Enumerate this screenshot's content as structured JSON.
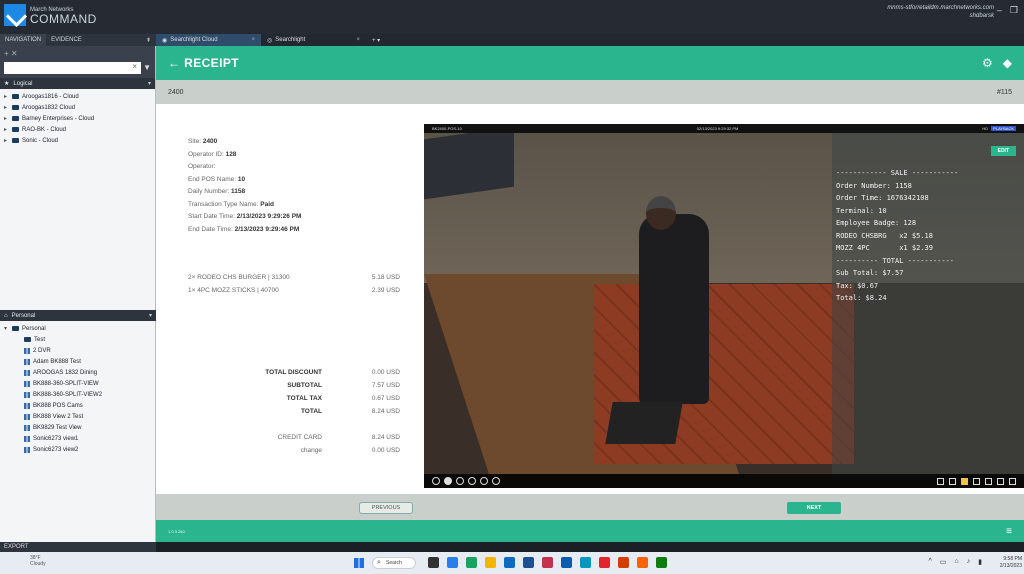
{
  "app": {
    "logo_line1": "March Networks",
    "logo_line2": "COMMAND",
    "host": "mnms-stforretaildm.marchnetworks.com",
    "user": "shdbarsk"
  },
  "nav_tabs": [
    "NAVIGATION",
    "EVIDENCE"
  ],
  "browser_tabs": [
    {
      "label": "Searchlight Cloud"
    },
    {
      "label": "Searchlight"
    }
  ],
  "sidebar": {
    "logical_label": "Logical",
    "logical_items": [
      "Aroogas1816 - Cloud",
      "Aroogas1832 Cloud",
      "Barney Enterprises - Cloud",
      "RAO-BK - Cloud",
      "Sonic - Cloud"
    ],
    "personal_label": "Personal",
    "personal_root": "Personal",
    "personal_items": [
      {
        "label": "Test",
        "icon": "folder"
      },
      {
        "label": "2 DVR",
        "icon": "grid"
      },
      {
        "label": "Adam BK888 Test",
        "icon": "grid"
      },
      {
        "label": "AROOGAS 1832 Dining",
        "icon": "grid"
      },
      {
        "label": "BK888-360-SPLIT-VIEW",
        "icon": "grid"
      },
      {
        "label": "BK888-360-SPLIT-VIEW2",
        "icon": "grid"
      },
      {
        "label": "BK888 POS Cams",
        "icon": "grid"
      },
      {
        "label": "BK888 View 2 Test",
        "icon": "grid"
      },
      {
        "label": "BK9829 Test View",
        "icon": "grid"
      },
      {
        "label": "Sonic6273 view1",
        "icon": "grid"
      },
      {
        "label": "Sonic6273 view2",
        "icon": "grid"
      }
    ],
    "export_label": "EXPORT"
  },
  "page": {
    "title": "RECEIPT",
    "site_code": "2400",
    "receipt_ref": "#115"
  },
  "receipt": {
    "fields": [
      {
        "label": "Site:",
        "value": "2400"
      },
      {
        "label": "Operator ID:",
        "value": "128"
      },
      {
        "label": "Operator:",
        "value": ""
      },
      {
        "label": "End POS Name:",
        "value": "10"
      },
      {
        "label": "Daily Number:",
        "value": "1158"
      },
      {
        "label": "Transaction Type Name:",
        "value": "Paid"
      },
      {
        "label": "Start Date Time:",
        "value": "2/13/2023 9:29:26 PM"
      },
      {
        "label": "End Date Time:",
        "value": "2/13/2023 9:29:46 PM"
      }
    ],
    "line_items": [
      {
        "desc": "2× RODEO CHS BURGER | 31300",
        "amount": "5.18 USD"
      },
      {
        "desc": "1× 4PC MOZZ STICKS | 40700",
        "amount": "2.39 USD"
      }
    ],
    "totals": [
      {
        "label": "TOTAL DISCOUNT",
        "value": "0.00 USD",
        "bold": true
      },
      {
        "label": "SUBTOTAL",
        "value": "7.57 USD",
        "bold": true
      },
      {
        "label": "TOTAL TAX",
        "value": "0.67 USD",
        "bold": true
      },
      {
        "label": "TOTAL",
        "value": "8.24 USD",
        "bold": true
      },
      {
        "label": "",
        "value": "",
        "bold": false
      },
      {
        "label": "CREDIT CARD",
        "value": "8.24 USD",
        "bold": false
      },
      {
        "label": "change",
        "value": "0.00 USD",
        "bold": false
      }
    ]
  },
  "video": {
    "camera": "BK2400-POS-10",
    "timestamp": "02/13/2023 9:29:32 PM",
    "badge_hd": "HD",
    "badge_playback": "PLAYBACK",
    "edit_label": "EDIT",
    "overlay_lines": [
      "------------ SALE -----------",
      "Order Number: 1158",
      "Order Time: 1676342108",
      "Terminal: 10",
      "Employee Badge: 128",
      "RODEO CHSBRG   x2 $5.18",
      "MOZZ 4PC       x1 $2.39",
      "---------- TOTAL -----------",
      "Sub Total: $7.57",
      "Tax: $0.67",
      "Total: $8.24"
    ]
  },
  "buttons": {
    "previous": "PREVIOUS",
    "next": "NEXT"
  },
  "status": {
    "version": "1.0.3.260"
  },
  "taskbar": {
    "weather_temp": "38°F",
    "weather_desc": "Cloudy",
    "search_label": "Search",
    "time": "9:58 PM",
    "date": "2/13/2023",
    "app_colors": [
      "#333333",
      "#2b7de9",
      "#1aa260",
      "#f4b400",
      "#0f6cbd",
      "#1d4f91",
      "#c4314b",
      "#0b5cad",
      "#0099bc",
      "#e3262e",
      "#d83b01",
      "#f7630c",
      "#107c10"
    ]
  }
}
